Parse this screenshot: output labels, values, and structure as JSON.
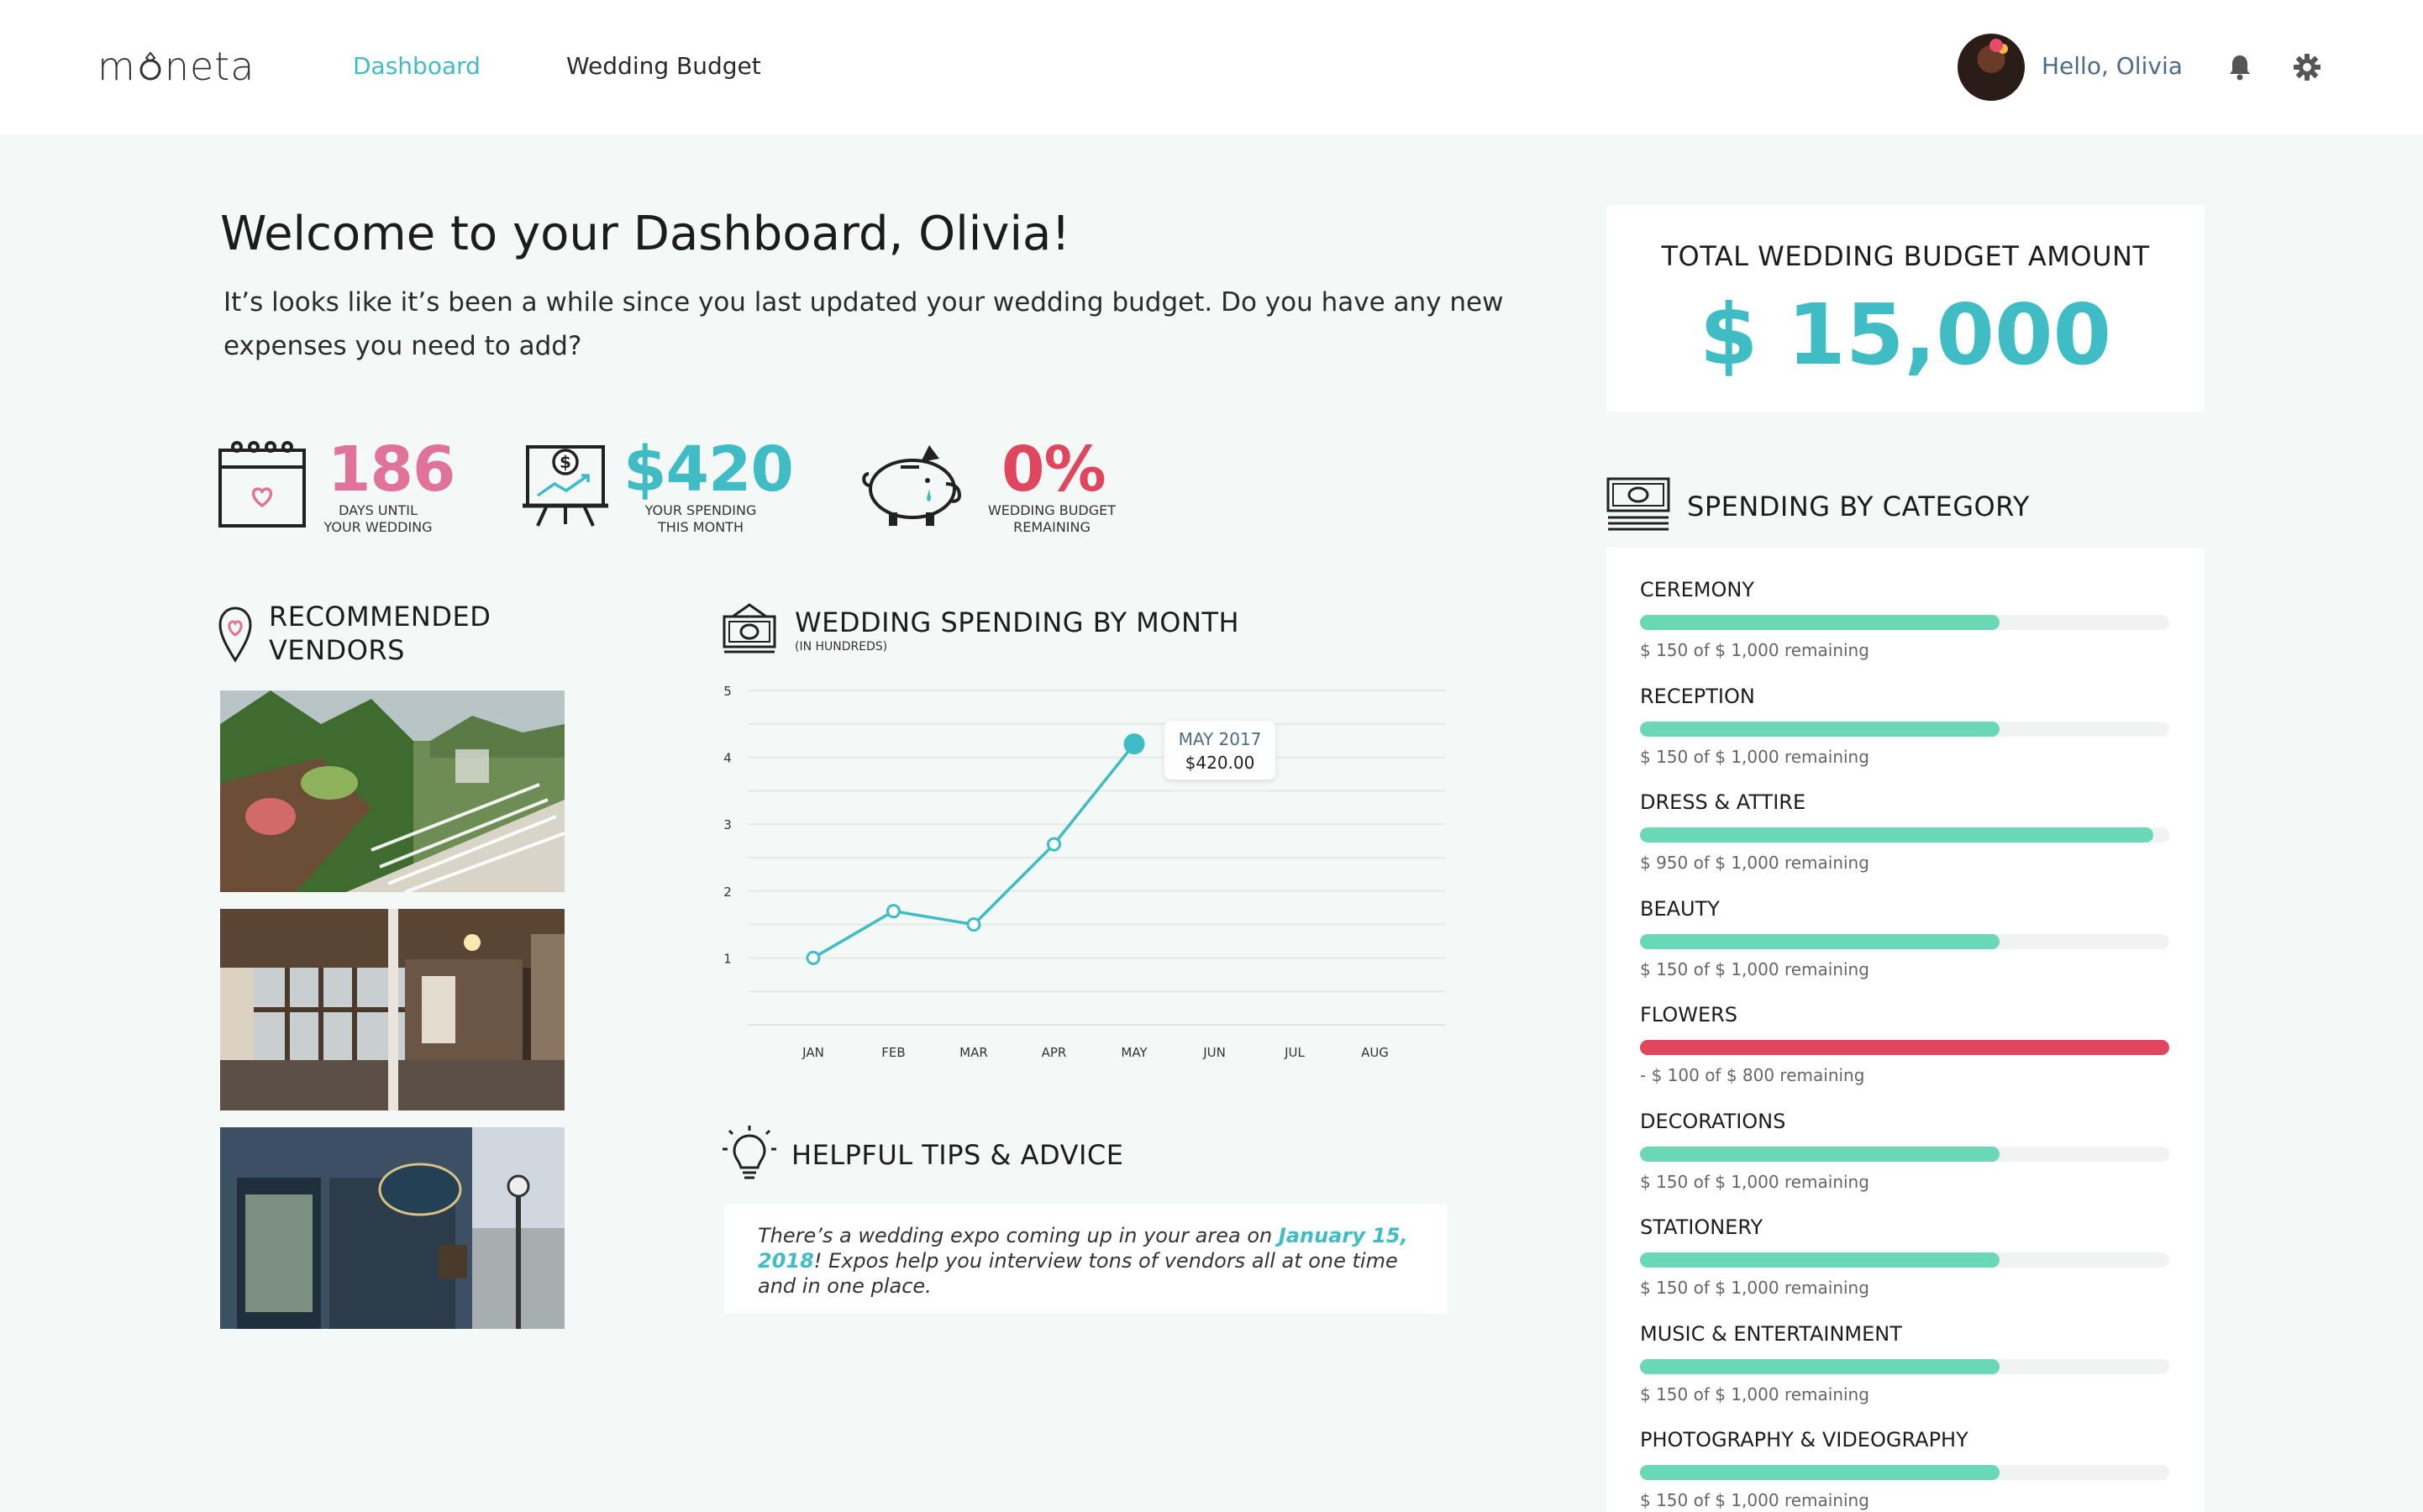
{
  "app": {
    "logo_text_pre": "m",
    "logo_text_post": "neta"
  },
  "nav": {
    "items": [
      {
        "label": "Dashboard",
        "active": true
      },
      {
        "label": "Wedding Budget",
        "active": false
      }
    ],
    "greeting": "Hello, Olivia"
  },
  "welcome": {
    "title": "Welcome to your Dashboard, Olivia!",
    "text": "It’s looks like it’s been a while since you last updated your wedding budget.  Do you have any new expenses you need to add?"
  },
  "stats": [
    {
      "value": "186",
      "label_line1": "DAYS UNTIL",
      "label_line2": "YOUR WEDDING",
      "color": "#e0739a",
      "icon": "calendar-heart-icon"
    },
    {
      "value": "$420",
      "label_line1": "YOUR SPENDING",
      "label_line2": "THIS MONTH",
      "color": "#3fbcc4",
      "icon": "presentation-dollar-icon"
    },
    {
      "value": "0%",
      "label_line1": "WEDDING BUDGET",
      "label_line2": "REMAINING",
      "color": "#e0475f",
      "icon": "piggy-bank-icon"
    }
  ],
  "vendors": {
    "title_line1": "RECOMMENDED",
    "title_line2": "VENDORS",
    "icon": "map-pin-heart-icon"
  },
  "spending_chart": {
    "title": "WEDDING SPENDING BY MONTH",
    "subtitle": "(IN HUNDREDS)",
    "icon": "money-bill-icon",
    "tooltip_month": "MAY 2017",
    "tooltip_value": "$420.00"
  },
  "chart_data": {
    "type": "line",
    "title": "WEDDING SPENDING BY MONTH",
    "subtitle": "(IN HUNDREDS)",
    "categories": [
      "JAN",
      "FEB",
      "MAR",
      "APR",
      "MAY",
      "JUN",
      "JUL",
      "AUG"
    ],
    "series": [
      {
        "values": [
          1.0,
          1.7,
          1.5,
          2.7,
          4.2,
          null,
          null,
          null
        ]
      }
    ],
    "yticks": [
      "1",
      "2",
      "3",
      "4",
      "5"
    ],
    "ylim": [
      0,
      5
    ],
    "grid": true,
    "line_color": "#3fbcc4"
  },
  "tips": {
    "title": "HELPFUL TIPS & ADVICE",
    "icon": "lightbulb-icon",
    "text_before": "There’s a wedding expo coming up in your area on ",
    "highlight": "January 15, 2018",
    "text_after": "!  Expos help you interview tons of vendors all at one time and in one place."
  },
  "budget": {
    "label": "TOTAL WEDDING BUDGET AMOUNT",
    "amount": "$ 15,000"
  },
  "categories": {
    "title": "SPENDING BY CATEGORY",
    "icon": "cash-stack-icon",
    "items": [
      {
        "name": "CEREMONY",
        "remaining": "$ 150 of $ 1,000 remaining",
        "fill": 0.68,
        "color": "#6ad8b4"
      },
      {
        "name": "RECEPTION",
        "remaining": "$ 150 of $ 1,000 remaining",
        "fill": 0.68,
        "color": "#6ad8b4"
      },
      {
        "name": "DRESS & ATTIRE",
        "remaining": "$ 950 of $ 1,000 remaining",
        "fill": 0.97,
        "color": "#6ad8b4"
      },
      {
        "name": "BEAUTY",
        "remaining": "$ 150 of $ 1,000 remaining",
        "fill": 0.68,
        "color": "#6ad8b4"
      },
      {
        "name": "FLOWERS",
        "remaining": "- $ 100 of $ 800 remaining",
        "fill": 1.0,
        "color": "#e0475f"
      },
      {
        "name": "DECORATIONS",
        "remaining": "$ 150 of $ 1,000 remaining",
        "fill": 0.68,
        "color": "#6ad8b4"
      },
      {
        "name": "STATIONERY",
        "remaining": "$ 150 of $ 1,000 remaining",
        "fill": 0.68,
        "color": "#6ad8b4"
      },
      {
        "name": "MUSIC & ENTERTAINMENT",
        "remaining": "$ 150 of $ 1,000 remaining",
        "fill": 0.68,
        "color": "#6ad8b4"
      },
      {
        "name": "PHOTOGRAPHY & VIDEOGRAPHY",
        "remaining": "$ 150 of $ 1,000 remaining",
        "fill": 0.68,
        "color": "#6ad8b4"
      }
    ]
  }
}
